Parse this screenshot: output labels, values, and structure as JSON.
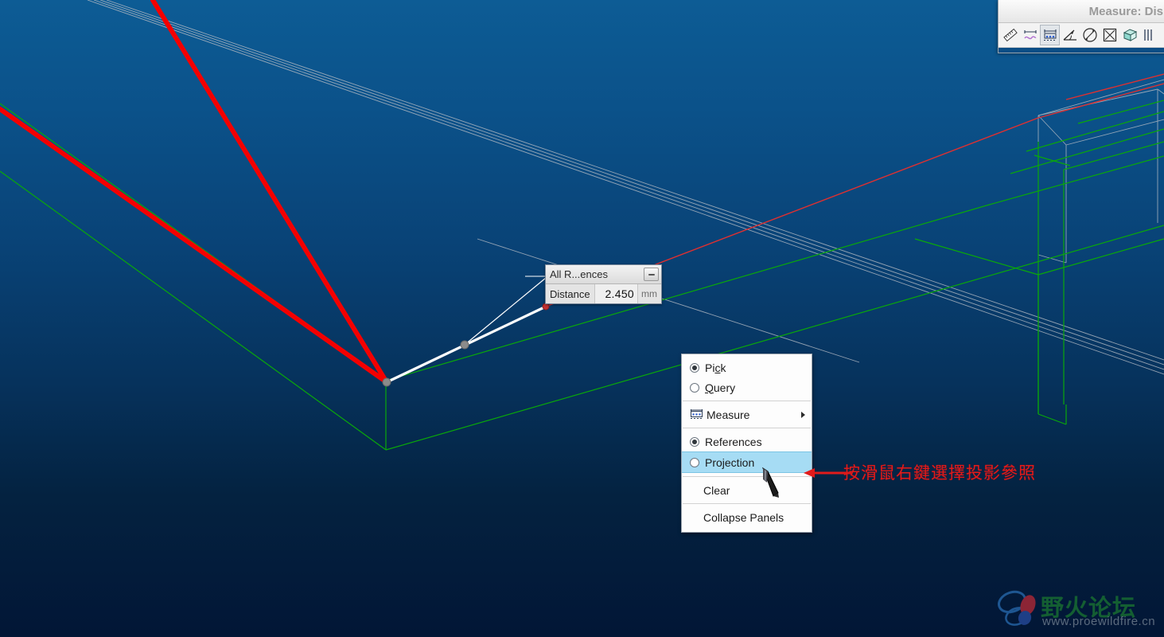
{
  "window": {
    "title": "Measure: Dis",
    "toolbar_icons": [
      "ruler-icon",
      "curve-length-icon",
      "distance-icon",
      "angle-icon",
      "diameter-icon",
      "area-icon",
      "volume-icon",
      "transform-icon"
    ],
    "toolbar_pressed_index": 2
  },
  "measure_dialog": {
    "title": "All R...ences",
    "collapse_tooltip": "Collapse",
    "row": {
      "label": "Distance",
      "value": "2.450",
      "unit": "mm"
    }
  },
  "context_menu": {
    "items": [
      {
        "label": "Pick",
        "mnemonic": "c",
        "type": "radio",
        "selected": true
      },
      {
        "label": "Query",
        "mnemonic": "Q",
        "type": "radio",
        "selected": false
      },
      {
        "label": "Measure",
        "type": "submenu",
        "icon": "measure-icon"
      },
      {
        "label": "References",
        "type": "radio",
        "selected": true
      },
      {
        "label": "Projection",
        "type": "radio",
        "selected": false,
        "highlighted": true
      },
      {
        "label": "Clear",
        "type": "plain"
      },
      {
        "label": "Collapse Panels",
        "type": "plain"
      }
    ]
  },
  "annotation": {
    "text": "按滑鼠右鍵選擇投影參照",
    "color": "#e11b1b"
  },
  "watermark": {
    "name": "野火论坛",
    "url": "www.proewildfire.cn"
  },
  "colors": {
    "background_top": "#0d5c95",
    "background_bottom": "#021636",
    "highlight_edge": "#f00000",
    "model_edge_green": "#00a000",
    "model_edge_gray": "#b9bfc7",
    "measure_line": "#ffffff",
    "menu_highlight": "#a6dcf4"
  }
}
